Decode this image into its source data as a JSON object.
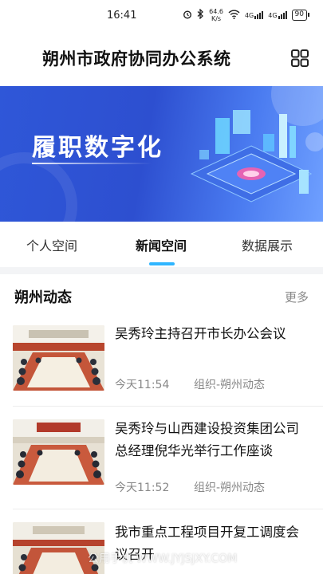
{
  "status_bar": {
    "time": "16:41",
    "net_speed_value": "64.6",
    "net_speed_unit": "K/s",
    "signal_1": "4G",
    "signal_2": "4G",
    "battery": "90"
  },
  "header": {
    "title": "朔州市政府协同办公系统"
  },
  "banner": {
    "text": "履职数字化",
    "page_count": 4,
    "active_page": 1,
    "colors": {
      "start": "#2f57d8",
      "end": "#6fa0ff"
    }
  },
  "tabs": [
    {
      "label": "个人空间",
      "active": false
    },
    {
      "label": "新闻空间",
      "active": true
    },
    {
      "label": "数据展示",
      "active": false
    }
  ],
  "section": {
    "title": "朔州动态",
    "more_label": "更多"
  },
  "news": [
    {
      "title": "吴秀玲主持召开市长办公会议",
      "time": "今天11:54",
      "source": "组织-朔州动态"
    },
    {
      "title": "吴秀玲与山西建设投资集团公司总经理倪华光举行工作座谈",
      "time": "今天11:52",
      "source": "组织-朔州动态"
    },
    {
      "title": "我市重点工程项目开复工调度会议召开",
      "time": "",
      "source": ""
    }
  ],
  "watermark": "公用手机 WWW.JYJSJXY.COM",
  "accent_color": "#2fb5ff"
}
